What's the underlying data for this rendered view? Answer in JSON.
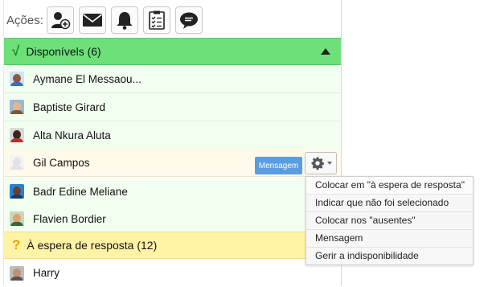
{
  "actions": {
    "label": "Ações:",
    "buttons": [
      {
        "icon": "add-user-icon"
      },
      {
        "icon": "envelope-icon"
      },
      {
        "icon": "bell-icon"
      },
      {
        "icon": "clipboard-checklist-icon"
      },
      {
        "icon": "chat-bubble-icon"
      }
    ]
  },
  "groups": {
    "available": {
      "check": "√",
      "title": "Disponívels (6)",
      "color": "#6ee07a"
    },
    "waiting": {
      "mark": "?",
      "title": "À espera de resposta (12)",
      "color": "#fff3a6"
    }
  },
  "available_people": [
    {
      "name": "Aymane El Messaou..."
    },
    {
      "name": "Baptiste Girard"
    },
    {
      "name": "Alta Nkura Aluta"
    },
    {
      "name": "Gil Campos"
    },
    {
      "name": "Badr Edine Meliane"
    },
    {
      "name": "Flavien Bordier"
    }
  ],
  "waiting_people": [
    {
      "name": "Harry"
    }
  ],
  "row_actions": {
    "message_button": "Mensagem",
    "accent": "#5b9ee0"
  },
  "context_menu": {
    "items": [
      "Colocar em \"à espera de resposta\"",
      "Indicar que não foi selecionado",
      "Colocar nos \"ausentes\"",
      "Mensagem",
      "Gerir a indisponibilidade"
    ]
  }
}
